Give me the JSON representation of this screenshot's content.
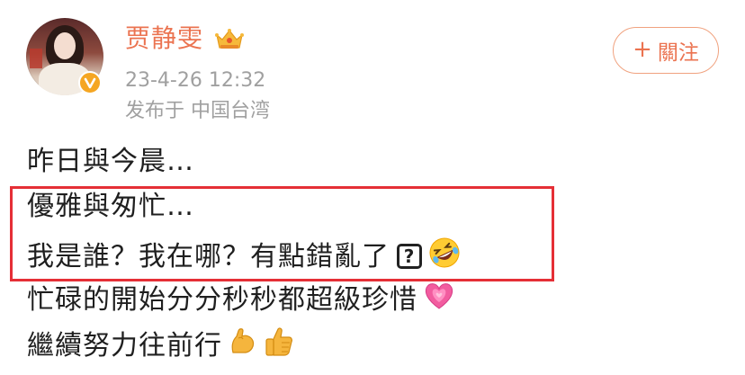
{
  "post": {
    "username": "贾静雯",
    "timestamp": "23-4-26 12:32",
    "source": "发布于 中国台湾",
    "follow": {
      "plus": "+",
      "label": "關注"
    },
    "content": {
      "line1": "昨日與今晨…",
      "line2": "優雅與匆忙…",
      "line3": "我是誰？我在哪？有點錯亂了",
      "line3_qbox": "?",
      "line4": "忙碌的開始分分秒秒都超級珍惜",
      "line5": "繼續努力往前行"
    },
    "icons": {
      "crown": "crown-badge-icon",
      "verified": "verified-v-icon",
      "qbox": "question-box-emoji",
      "laugh": "rolling-laughing-emoji",
      "heart": "growing-heart-emoji",
      "muscle": "flexed-biceps-emoji",
      "thumbs": "thumbs-up-emoji"
    },
    "colors": {
      "username": "#eb7350",
      "meta": "#a0a0a0",
      "follow_border": "#f0a27f",
      "highlight": "#e52f36",
      "verified_badge": "#f5a623"
    }
  }
}
